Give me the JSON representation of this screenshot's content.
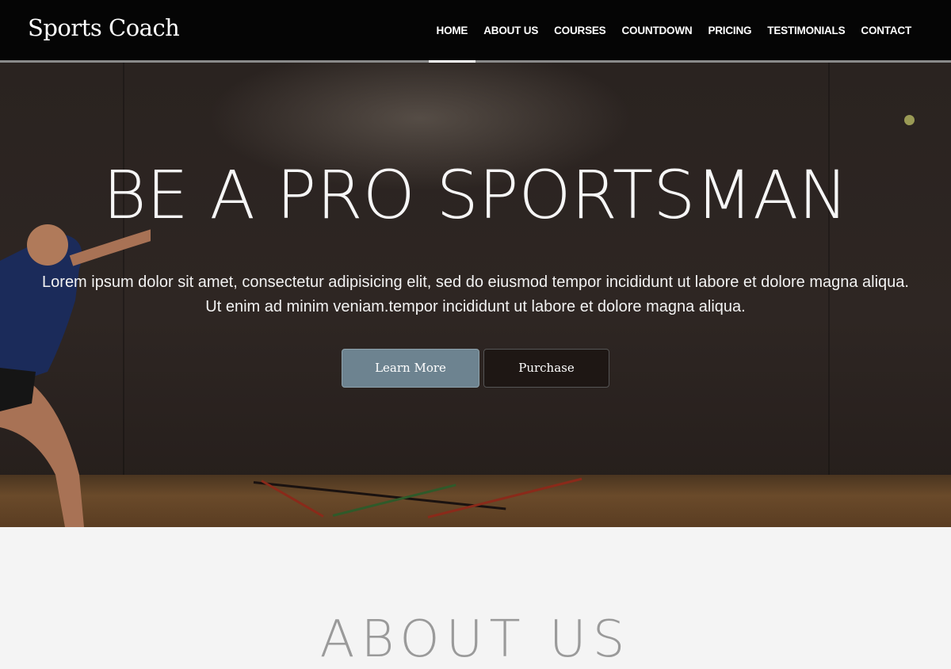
{
  "nav": {
    "brand": "Sports Coach",
    "items": [
      "HOME",
      "ABOUT US",
      "COURSES",
      "COUNTDOWN",
      "PRICING",
      "TESTIMONIALS",
      "CONTACT"
    ],
    "active": "HOME"
  },
  "hero": {
    "title": "BE A PRO SPORTSMAN",
    "text": "Lorem ipsum dolor sit amet, consectetur adipisicing elit, sed do eiusmod tempor incididunt ut labore et dolore magna aliqua. Ut enim ad minim veniam.tempor incididunt ut labore et dolore magna aliqua.",
    "learn_more_label": "Learn More",
    "purchase_label": "Purchase"
  },
  "about": {
    "title": "ABOUT US"
  },
  "colors": {
    "nav_bg": "#050505",
    "learn_more_bg": "#6d8390",
    "section_bg": "#f4f4f4"
  }
}
